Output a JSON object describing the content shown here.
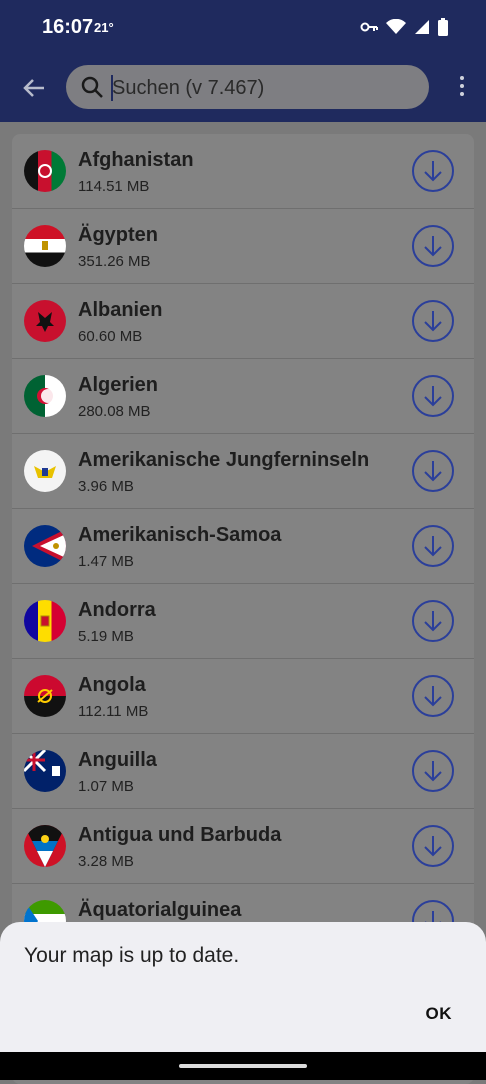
{
  "status": {
    "time": "16:07",
    "temperature": "21°"
  },
  "search": {
    "placeholder": "Suchen (v 7.467)"
  },
  "countries": [
    {
      "name": "Afghanistan",
      "size": "114.51 MB"
    },
    {
      "name": "Ägypten",
      "size": "351.26 MB"
    },
    {
      "name": "Albanien",
      "size": "60.60 MB"
    },
    {
      "name": "Algerien",
      "size": "280.08 MB"
    },
    {
      "name": "Amerikanische Jungferninseln",
      "size": "3.96 MB"
    },
    {
      "name": "Amerikanisch-Samoa",
      "size": "1.47 MB"
    },
    {
      "name": "Andorra",
      "size": "5.19 MB"
    },
    {
      "name": "Angola",
      "size": "112.11 MB"
    },
    {
      "name": "Anguilla",
      "size": "1.07 MB"
    },
    {
      "name": "Antigua und Barbuda",
      "size": "3.28 MB"
    },
    {
      "name": "Äquatorialguinea",
      "size": ""
    }
  ],
  "dialog": {
    "message": "Your map is up to date.",
    "ok_label": "OK"
  },
  "colors": {
    "appbar": "#1f2a5e",
    "accent": "#2b3f9a",
    "scrim": "#7a7a7a",
    "dialog": "#efeff3"
  }
}
